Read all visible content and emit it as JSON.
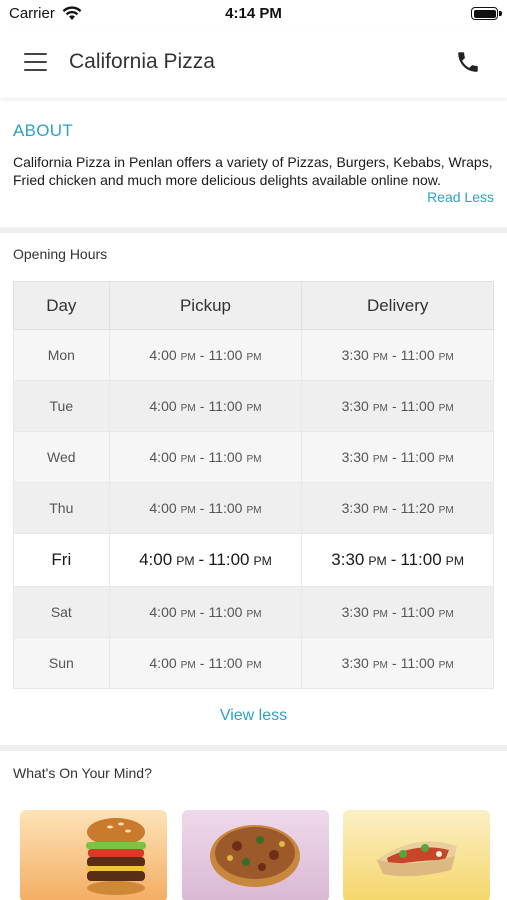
{
  "status_bar": {
    "carrier": "Carrier",
    "time": "4:14 PM"
  },
  "header": {
    "title": "California Pizza",
    "menu_icon": "hamburger-menu-icon",
    "call_icon": "phone-icon"
  },
  "about": {
    "title": "ABOUT",
    "text": "California Pizza in Penlan offers a variety of Pizzas, Burgers, Kebabs, Wraps, Fried chicken and much more delicious delights available online now.",
    "toggle_label": "Read Less"
  },
  "opening_hours": {
    "title": "Opening Hours",
    "columns": [
      "Day",
      "Pickup",
      "Delivery"
    ],
    "rows": [
      {
        "day": "Mon",
        "pickup_open": "4:00",
        "pickup_close": "11:00",
        "delivery_open": "3:30",
        "delivery_close": "11:00"
      },
      {
        "day": "Tue",
        "pickup_open": "4:00",
        "pickup_close": "11:00",
        "delivery_open": "3:30",
        "delivery_close": "11:00"
      },
      {
        "day": "Wed",
        "pickup_open": "4:00",
        "pickup_close": "11:00",
        "delivery_open": "3:30",
        "delivery_close": "11:00"
      },
      {
        "day": "Thu",
        "pickup_open": "4:00",
        "pickup_close": "11:00",
        "delivery_open": "3:30",
        "delivery_close": "11:20"
      },
      {
        "day": "Fri",
        "pickup_open": "4:00",
        "pickup_close": "11:00",
        "delivery_open": "3:30",
        "delivery_close": "11:00"
      },
      {
        "day": "Sat",
        "pickup_open": "4:00",
        "pickup_close": "11:00",
        "delivery_open": "3:30",
        "delivery_close": "11:00"
      },
      {
        "day": "Sun",
        "pickup_open": "4:00",
        "pickup_close": "11:00",
        "delivery_open": "3:30",
        "delivery_close": "11:00"
      }
    ],
    "meridiem": "PM",
    "separator": "-",
    "today": "Fri",
    "toggle_label": "View less"
  },
  "whats_on_your_mind": {
    "title": "What's On Your Mind?",
    "cards": [
      {
        "icon": "burger-icon",
        "bg": "#f6c98a"
      },
      {
        "icon": "pizza-icon",
        "bg": "#e6cbe0"
      },
      {
        "icon": "wrap-icon",
        "bg": "#f7df86"
      }
    ]
  },
  "colors": {
    "accent": "#2fa0c4",
    "section_gap": "#efefef",
    "table_header": "#efefef"
  }
}
